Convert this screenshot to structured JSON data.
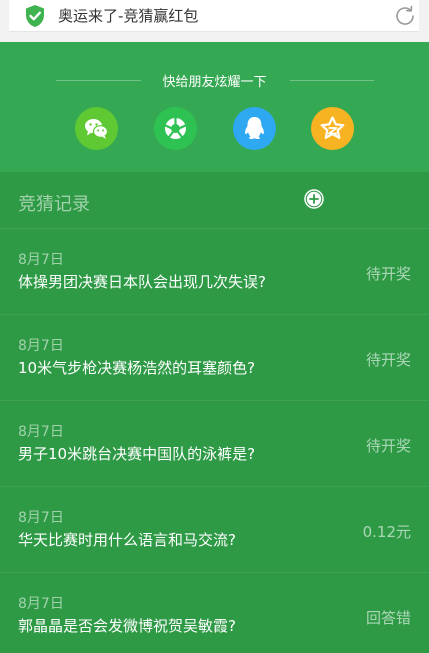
{
  "browser": {
    "title": "奥运来了-竞猜赢红包",
    "security_icon": "shield-check-icon",
    "refresh_icon": "refresh-icon"
  },
  "share": {
    "text": "快给朋友炫耀一下",
    "buttons": [
      {
        "name": "wechat",
        "icon": "wechat-icon",
        "color": "#5ec933"
      },
      {
        "name": "moments",
        "icon": "moments-icon",
        "color": "#2ec253"
      },
      {
        "name": "qq",
        "icon": "qq-icon",
        "color": "#2ea8f0"
      },
      {
        "name": "qzone",
        "icon": "qzone-star-icon",
        "color": "#f8b322"
      }
    ]
  },
  "records": {
    "title": "竞猜记录",
    "add_icon": "plus-circle-icon",
    "items": [
      {
        "date": "8月7日",
        "question": "体操男团决赛日本队会出现几次失误?",
        "status": "待开奖"
      },
      {
        "date": "8月7日",
        "question": "10米气步枪决赛杨浩然的耳塞颜色?",
        "status": "待开奖"
      },
      {
        "date": "8月7日",
        "question": "男子10米跳台决赛中国队的泳裤是?",
        "status": "待开奖"
      },
      {
        "date": "8月7日",
        "question": "华天比赛时用什么语言和马交流?",
        "status": "0.12元"
      },
      {
        "date": "8月7日",
        "question": "郭晶晶是否会发微博祝贺吴敏霞?",
        "status": "回答错"
      }
    ]
  },
  "colors": {
    "background": "#2e9a46",
    "share_bg": "#35a853",
    "shield": "#3fb34f"
  }
}
